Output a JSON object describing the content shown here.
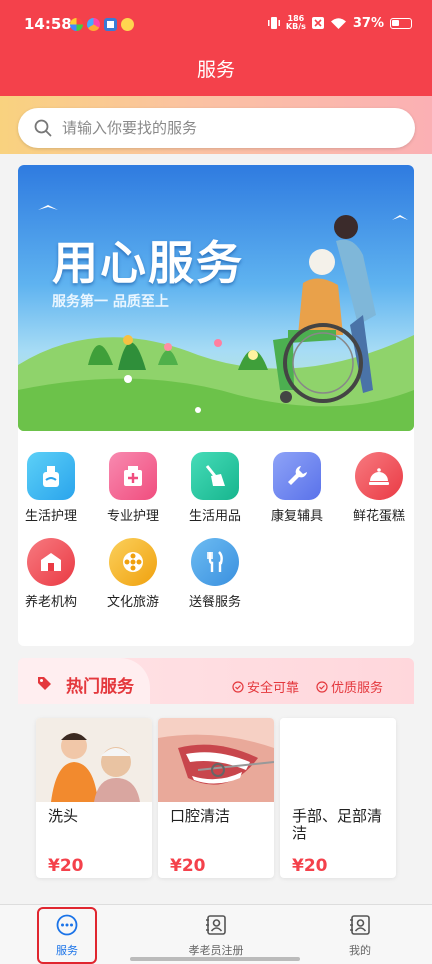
{
  "status_bar": {
    "time": "14:58",
    "speed_value": "186",
    "speed_unit": "KB/s",
    "battery": "37%"
  },
  "header": {
    "title": "服务"
  },
  "search": {
    "placeholder": "请输入你要找的服务"
  },
  "banner": {
    "title": "用心服务",
    "subtitle": "服务第一 品质至上"
  },
  "categories": [
    {
      "label": "生活护理",
      "icon": "lotion-bottle-icon",
      "color": "#3cb8f2"
    },
    {
      "label": "专业护理",
      "icon": "medicine-box-icon",
      "color": "#f2658f"
    },
    {
      "label": "生活用品",
      "icon": "broom-icon",
      "color": "#25c7a3"
    },
    {
      "label": "康复辅具",
      "icon": "wrench-icon",
      "color": "#6b86f0"
    },
    {
      "label": "鲜花蛋糕",
      "icon": "cake-dome-icon",
      "color": "#f04e57"
    },
    {
      "label": "养老机构",
      "icon": "building-icon",
      "color": "#f2555e"
    },
    {
      "label": "文化旅游",
      "icon": "film-reel-icon",
      "color": "#f5b325"
    },
    {
      "label": "送餐服务",
      "icon": "fork-knife-icon",
      "color": "#48a4e8"
    }
  ],
  "hot": {
    "title": "热门服务",
    "badges": [
      "安全可靠",
      "优质服务"
    ],
    "products": [
      {
        "name": "洗头",
        "price": "¥20"
      },
      {
        "name": "口腔清洁",
        "price": "¥20"
      },
      {
        "name": "手部、足部清洁",
        "price": "¥20"
      }
    ]
  },
  "nav": {
    "items": [
      "服务",
      "孝老员注册",
      "我的"
    ],
    "active": "服务"
  },
  "colors": {
    "primary": "#f4414b",
    "nav_active": "#1a73e8"
  }
}
